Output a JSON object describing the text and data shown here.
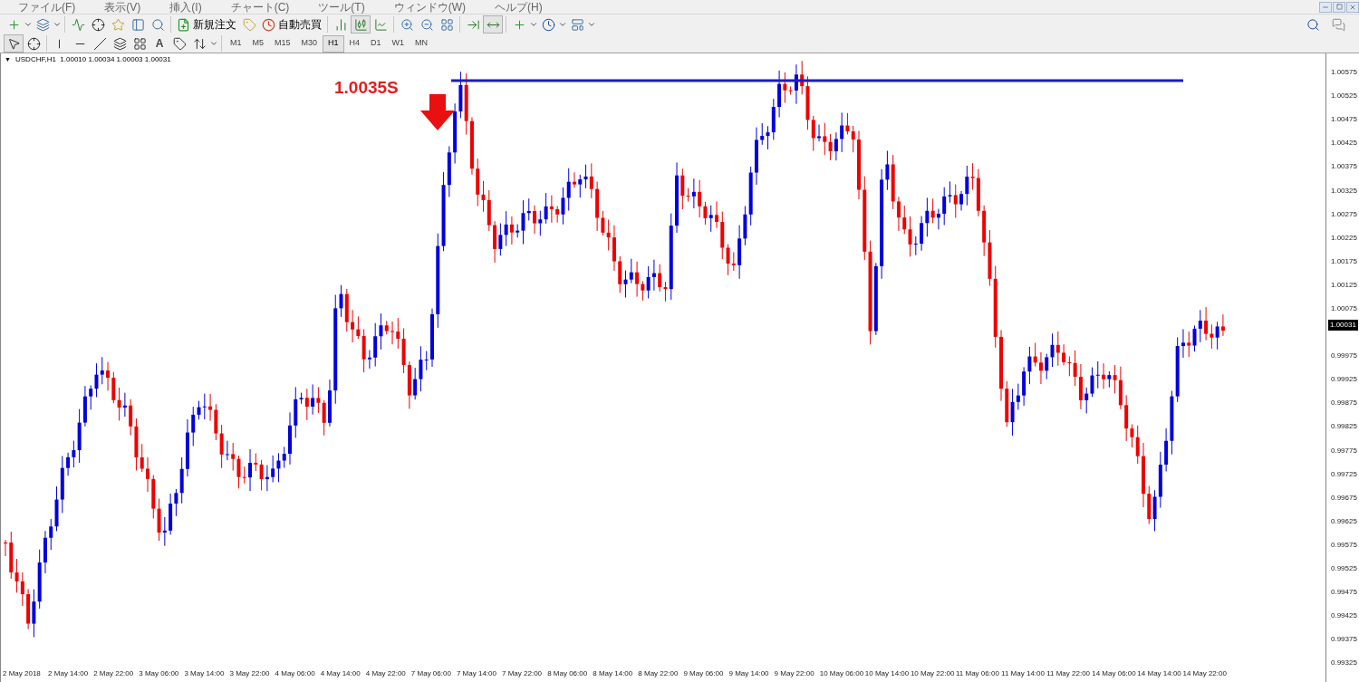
{
  "menu": [
    "ファイル(F)",
    "表示(V)",
    "挿入(I)",
    "チャート(C)",
    "ツール(T)",
    "ウィンドウ(W)",
    "ヘルプ(H)"
  ],
  "toolbar": {
    "order_button": "新規注文",
    "autotrade_button": "自動売買"
  },
  "drawing_tools": {
    "text_tool": "A"
  },
  "timeframes": [
    {
      "label": "M1",
      "selected": false
    },
    {
      "label": "M5",
      "selected": false
    },
    {
      "label": "M15",
      "selected": false
    },
    {
      "label": "M30",
      "selected": false
    },
    {
      "label": "H1",
      "selected": true
    },
    {
      "label": "H4",
      "selected": false
    },
    {
      "label": "D1",
      "selected": false
    },
    {
      "label": "W1",
      "selected": false
    },
    {
      "label": "MN",
      "selected": false
    }
  ],
  "chart": {
    "collapse_icon": "▼",
    "header": "USDCHF,H1  1.00010 1.00034 1.00003 1.00031",
    "annotation": "1.0035S",
    "current_price": "1.00031",
    "price_labels": [
      "1.00575",
      "1.00525",
      "1.00475",
      "1.00425",
      "1.00375",
      "1.00325",
      "1.00275",
      "1.00225",
      "1.00175",
      "1.00125",
      "1.00075"
    ],
    "price_labels_lower": [
      "0.99975",
      "0.99925",
      "0.99875",
      "0.99825",
      "0.99775",
      "0.99725",
      "0.99675",
      "0.99625",
      "0.99575",
      "0.99525",
      "0.99475",
      "0.99425",
      "0.99375",
      "0.99325"
    ],
    "time_labels": [
      "2 May 2018",
      "2 May 14:00",
      "2 May 22:00",
      "3 May 06:00",
      "3 May 14:00",
      "3 May 22:00",
      "4 May 06:00",
      "4 May 14:00",
      "4 May 22:00",
      "7 May 06:00",
      "7 May 14:00",
      "7 May 22:00",
      "8 May 06:00",
      "8 May 14:00",
      "8 May 22:00",
      "9 May 06:00",
      "9 May 14:00",
      "9 May 22:00",
      "10 May 06:00",
      "10 May 14:00",
      "10 May 22:00",
      "11 May 06:00",
      "11 May 14:00",
      "11 May 22:00",
      "14 May 06:00",
      "14 May 14:00",
      "14 May 22:00"
    ]
  }
}
